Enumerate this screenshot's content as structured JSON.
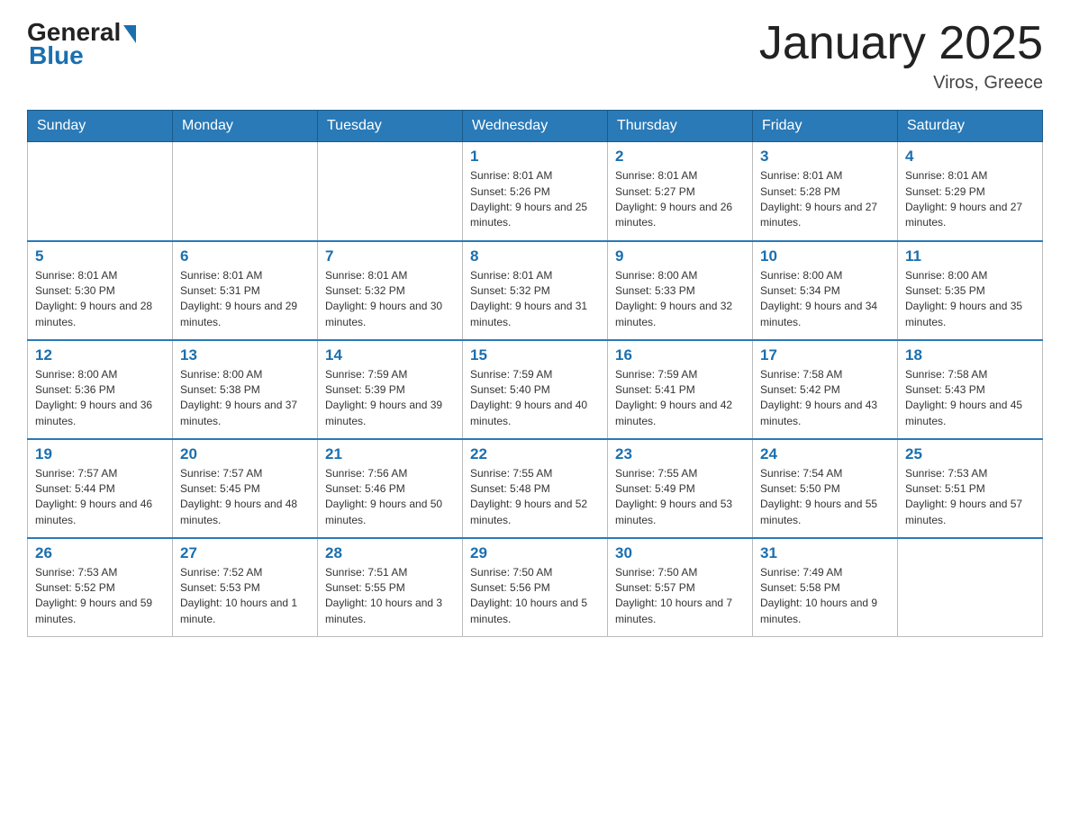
{
  "logo": {
    "general": "General",
    "blue": "Blue"
  },
  "title": "January 2025",
  "location": "Viros, Greece",
  "weekdays": [
    "Sunday",
    "Monday",
    "Tuesday",
    "Wednesday",
    "Thursday",
    "Friday",
    "Saturday"
  ],
  "weeks": [
    [
      {
        "day": "",
        "sunrise": "",
        "sunset": "",
        "daylight": ""
      },
      {
        "day": "",
        "sunrise": "",
        "sunset": "",
        "daylight": ""
      },
      {
        "day": "",
        "sunrise": "",
        "sunset": "",
        "daylight": ""
      },
      {
        "day": "1",
        "sunrise": "Sunrise: 8:01 AM",
        "sunset": "Sunset: 5:26 PM",
        "daylight": "Daylight: 9 hours and 25 minutes."
      },
      {
        "day": "2",
        "sunrise": "Sunrise: 8:01 AM",
        "sunset": "Sunset: 5:27 PM",
        "daylight": "Daylight: 9 hours and 26 minutes."
      },
      {
        "day": "3",
        "sunrise": "Sunrise: 8:01 AM",
        "sunset": "Sunset: 5:28 PM",
        "daylight": "Daylight: 9 hours and 27 minutes."
      },
      {
        "day": "4",
        "sunrise": "Sunrise: 8:01 AM",
        "sunset": "Sunset: 5:29 PM",
        "daylight": "Daylight: 9 hours and 27 minutes."
      }
    ],
    [
      {
        "day": "5",
        "sunrise": "Sunrise: 8:01 AM",
        "sunset": "Sunset: 5:30 PM",
        "daylight": "Daylight: 9 hours and 28 minutes."
      },
      {
        "day": "6",
        "sunrise": "Sunrise: 8:01 AM",
        "sunset": "Sunset: 5:31 PM",
        "daylight": "Daylight: 9 hours and 29 minutes."
      },
      {
        "day": "7",
        "sunrise": "Sunrise: 8:01 AM",
        "sunset": "Sunset: 5:32 PM",
        "daylight": "Daylight: 9 hours and 30 minutes."
      },
      {
        "day": "8",
        "sunrise": "Sunrise: 8:01 AM",
        "sunset": "Sunset: 5:32 PM",
        "daylight": "Daylight: 9 hours and 31 minutes."
      },
      {
        "day": "9",
        "sunrise": "Sunrise: 8:00 AM",
        "sunset": "Sunset: 5:33 PM",
        "daylight": "Daylight: 9 hours and 32 minutes."
      },
      {
        "day": "10",
        "sunrise": "Sunrise: 8:00 AM",
        "sunset": "Sunset: 5:34 PM",
        "daylight": "Daylight: 9 hours and 34 minutes."
      },
      {
        "day": "11",
        "sunrise": "Sunrise: 8:00 AM",
        "sunset": "Sunset: 5:35 PM",
        "daylight": "Daylight: 9 hours and 35 minutes."
      }
    ],
    [
      {
        "day": "12",
        "sunrise": "Sunrise: 8:00 AM",
        "sunset": "Sunset: 5:36 PM",
        "daylight": "Daylight: 9 hours and 36 minutes."
      },
      {
        "day": "13",
        "sunrise": "Sunrise: 8:00 AM",
        "sunset": "Sunset: 5:38 PM",
        "daylight": "Daylight: 9 hours and 37 minutes."
      },
      {
        "day": "14",
        "sunrise": "Sunrise: 7:59 AM",
        "sunset": "Sunset: 5:39 PM",
        "daylight": "Daylight: 9 hours and 39 minutes."
      },
      {
        "day": "15",
        "sunrise": "Sunrise: 7:59 AM",
        "sunset": "Sunset: 5:40 PM",
        "daylight": "Daylight: 9 hours and 40 minutes."
      },
      {
        "day": "16",
        "sunrise": "Sunrise: 7:59 AM",
        "sunset": "Sunset: 5:41 PM",
        "daylight": "Daylight: 9 hours and 42 minutes."
      },
      {
        "day": "17",
        "sunrise": "Sunrise: 7:58 AM",
        "sunset": "Sunset: 5:42 PM",
        "daylight": "Daylight: 9 hours and 43 minutes."
      },
      {
        "day": "18",
        "sunrise": "Sunrise: 7:58 AM",
        "sunset": "Sunset: 5:43 PM",
        "daylight": "Daylight: 9 hours and 45 minutes."
      }
    ],
    [
      {
        "day": "19",
        "sunrise": "Sunrise: 7:57 AM",
        "sunset": "Sunset: 5:44 PM",
        "daylight": "Daylight: 9 hours and 46 minutes."
      },
      {
        "day": "20",
        "sunrise": "Sunrise: 7:57 AM",
        "sunset": "Sunset: 5:45 PM",
        "daylight": "Daylight: 9 hours and 48 minutes."
      },
      {
        "day": "21",
        "sunrise": "Sunrise: 7:56 AM",
        "sunset": "Sunset: 5:46 PM",
        "daylight": "Daylight: 9 hours and 50 minutes."
      },
      {
        "day": "22",
        "sunrise": "Sunrise: 7:55 AM",
        "sunset": "Sunset: 5:48 PM",
        "daylight": "Daylight: 9 hours and 52 minutes."
      },
      {
        "day": "23",
        "sunrise": "Sunrise: 7:55 AM",
        "sunset": "Sunset: 5:49 PM",
        "daylight": "Daylight: 9 hours and 53 minutes."
      },
      {
        "day": "24",
        "sunrise": "Sunrise: 7:54 AM",
        "sunset": "Sunset: 5:50 PM",
        "daylight": "Daylight: 9 hours and 55 minutes."
      },
      {
        "day": "25",
        "sunrise": "Sunrise: 7:53 AM",
        "sunset": "Sunset: 5:51 PM",
        "daylight": "Daylight: 9 hours and 57 minutes."
      }
    ],
    [
      {
        "day": "26",
        "sunrise": "Sunrise: 7:53 AM",
        "sunset": "Sunset: 5:52 PM",
        "daylight": "Daylight: 9 hours and 59 minutes."
      },
      {
        "day": "27",
        "sunrise": "Sunrise: 7:52 AM",
        "sunset": "Sunset: 5:53 PM",
        "daylight": "Daylight: 10 hours and 1 minute."
      },
      {
        "day": "28",
        "sunrise": "Sunrise: 7:51 AM",
        "sunset": "Sunset: 5:55 PM",
        "daylight": "Daylight: 10 hours and 3 minutes."
      },
      {
        "day": "29",
        "sunrise": "Sunrise: 7:50 AM",
        "sunset": "Sunset: 5:56 PM",
        "daylight": "Daylight: 10 hours and 5 minutes."
      },
      {
        "day": "30",
        "sunrise": "Sunrise: 7:50 AM",
        "sunset": "Sunset: 5:57 PM",
        "daylight": "Daylight: 10 hours and 7 minutes."
      },
      {
        "day": "31",
        "sunrise": "Sunrise: 7:49 AM",
        "sunset": "Sunset: 5:58 PM",
        "daylight": "Daylight: 10 hours and 9 minutes."
      },
      {
        "day": "",
        "sunrise": "",
        "sunset": "",
        "daylight": ""
      }
    ]
  ]
}
